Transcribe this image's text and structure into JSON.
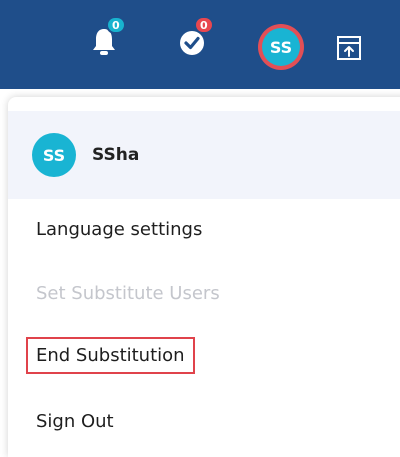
{
  "topbar": {
    "notifications": {
      "icon": "bell-icon",
      "count": "0",
      "badge_color": "#18b3cf"
    },
    "tasks": {
      "icon": "check-badge-icon",
      "count": "0",
      "badge_color": "#e8474f"
    },
    "avatar": {
      "initials": "SS",
      "ring_color": "#e24f56",
      "fill_color": "#19b4d3"
    },
    "panel_icon": "pin-panel-icon",
    "background": "#1f4e8a"
  },
  "menu": {
    "user": {
      "initials": "SS",
      "name": "SSha"
    },
    "items": [
      {
        "label": "Language settings",
        "state": "enabled"
      },
      {
        "label": "Set Substitute Users",
        "state": "disabled"
      },
      {
        "label": "End Substitution",
        "state": "highlighted"
      },
      {
        "label": "Sign Out",
        "state": "enabled"
      }
    ]
  }
}
